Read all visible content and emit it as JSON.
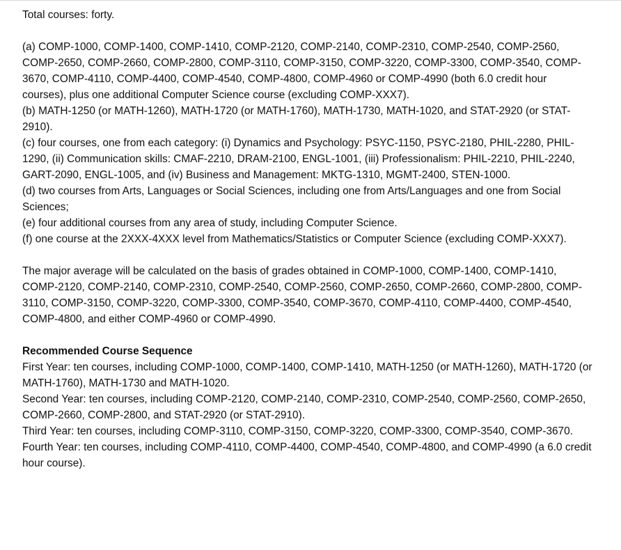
{
  "total": "Total courses: forty.",
  "requirements": [
    "(a) COMP-1000, COMP-1400, COMP-1410, COMP-2120, COMP-2140, COMP-2310, COMP-2540, COMP-2560, COMP-2650, COMP-2660, COMP-2800, COMP-3110, COMP-3150, COMP-3220, COMP-3300, COMP-3540, COMP-3670, COMP-4110, COMP-4400, COMP-4540, COMP-4800, COMP-4960 or COMP-4990 (both 6.0 credit hour courses), plus one additional Computer Science course (excluding COMP-XXX7).",
    "(b) MATH-1250 (or MATH-1260), MATH-1720 (or MATH-1760), MATH-1730, MATH-1020, and STAT-2920 (or STAT-2910).",
    "(c) four courses, one from each category: (i) Dynamics and Psychology: PSYC-1150, PSYC-2180, PHIL-2280, PHIL-1290, (ii) Communication skills: CMAF-2210, DRAM-2100, ENGL-1001, (iii) Professionalism: PHIL-2210, PHIL-2240, GART-2090, ENGL-1005, and (iv) Business and Management: MKTG-1310, MGMT-2400, STEN-1000.",
    "(d) two courses from Arts, Languages or Social Sciences, including one from Arts/Languages and one from Social Sciences;",
    "(e) four additional courses from any area of study, including Computer Science.",
    "(f) one course at the 2XXX-4XXX level from Mathematics/Statistics or Computer Science (excluding COMP-XXX7)."
  ],
  "major_average": "The major average will be calculated on the basis of grades obtained in COMP-1000, COMP-1400, COMP-1410, COMP-2120, COMP-2140, COMP-2310, COMP-2540, COMP-2560, COMP-2650, COMP-2660, COMP-2800, COMP-3110, COMP-3150, COMP-3220, COMP-3300, COMP-3540, COMP-3670, COMP-4110, COMP-4400, COMP-4540, COMP-4800, and either COMP-4960 or COMP-4990.",
  "sequence": {
    "heading": "Recommended Course Sequence",
    "years": [
      "First Year: ten courses, including COMP-1000, COMP-1400, COMP-1410, MATH-1250 (or MATH-1260), MATH-1720 (or MATH-1760), MATH-1730 and MATH-1020.",
      "Second Year: ten courses, including COMP-2120, COMP-2140, COMP-2310, COMP-2540, COMP-2560, COMP-2650, COMP-2660, COMP-2800, and STAT-2920 (or STAT-2910).",
      "Third Year: ten courses, including COMP-3110, COMP-3150, COMP-3220, COMP-3300, COMP-3540, COMP-3670.",
      "Fourth Year: ten courses, including COMP-4110, COMP-4400, COMP-4540, COMP-4800, and COMP-4990 (a 6.0 credit hour course)."
    ]
  }
}
